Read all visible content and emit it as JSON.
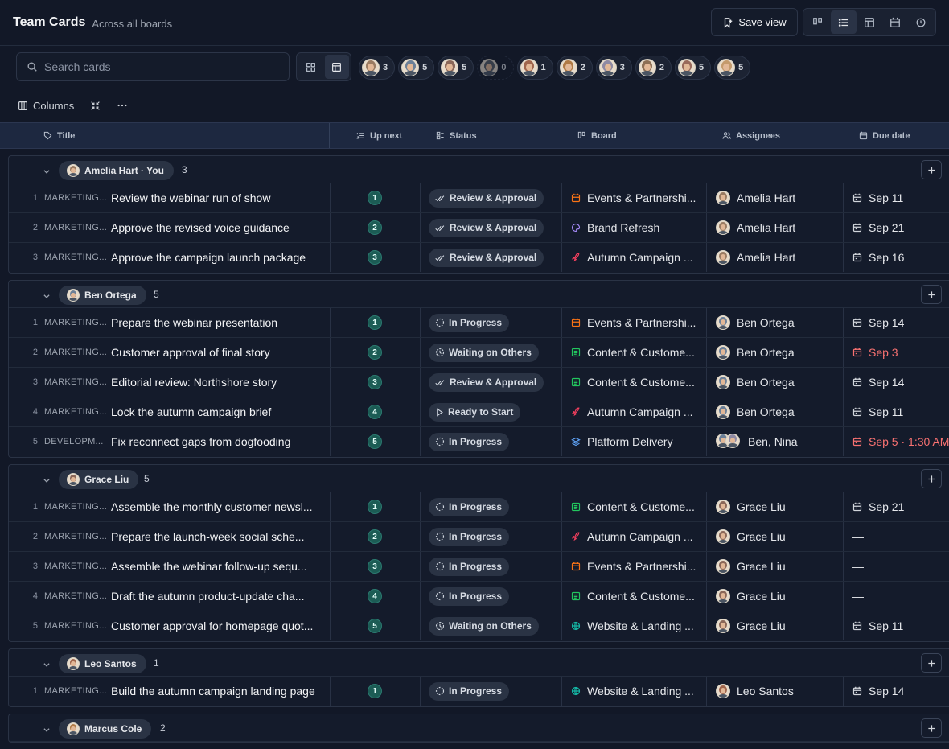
{
  "header": {
    "title": "Team Cards",
    "subtitle": "Across all boards",
    "save_view_label": "Save view"
  },
  "search": {
    "placeholder": "Search cards",
    "value": ""
  },
  "assignee_chips": [
    {
      "count": "3",
      "tone": "#9a7b62"
    },
    {
      "count": "5",
      "tone": "#6b7f97"
    },
    {
      "count": "5",
      "tone": "#8a6758"
    },
    {
      "count": "0",
      "tone": "#555c66"
    },
    {
      "count": "1",
      "tone": "#a0664d"
    },
    {
      "count": "2",
      "tone": "#b07a45"
    },
    {
      "count": "3",
      "tone": "#8f8aa3"
    },
    {
      "count": "2",
      "tone": "#8d6f55"
    },
    {
      "count": "5",
      "tone": "#9a6a5b"
    },
    {
      "count": "5",
      "tone": "#c49a6c"
    }
  ],
  "toolbar": {
    "columns_label": "Columns"
  },
  "columns": {
    "title": "Title",
    "up_next": "Up next",
    "status": "Status",
    "board": "Board",
    "assignees": "Assignees",
    "due_date": "Due date"
  },
  "colors": {
    "accent_teal": "#1c5c55",
    "overdue": "#f87171",
    "events": "#f97316",
    "brand": "#a78bfa",
    "content": "#22c55e",
    "autumn": "#f43f5e",
    "platform": "#60a5fa",
    "website": "#14b8a6"
  },
  "groups": [
    {
      "name": "Amelia Hart · You",
      "count": "3",
      "tone": "#9a7b62",
      "rows": [
        {
          "idx": "1",
          "prefix": "MARKETING...",
          "title": "Review the webinar run of show",
          "up": "1",
          "status": "Review & Approval",
          "status_icon": "review",
          "board": "Events & Partnershi...",
          "board_icon": "calendar",
          "board_color": "#f97316",
          "assignee": "Amelia Hart",
          "av": [
            "#9a7b62"
          ],
          "due": "Sep 11",
          "overdue": false
        },
        {
          "idx": "2",
          "prefix": "MARKETING...",
          "title": "Approve the revised voice guidance",
          "up": "2",
          "status": "Review & Approval",
          "status_icon": "review",
          "board": "Brand Refresh",
          "board_icon": "palette",
          "board_color": "#a78bfa",
          "assignee": "Amelia Hart",
          "av": [
            "#9a7b62"
          ],
          "due": "Sep 21",
          "overdue": false
        },
        {
          "idx": "3",
          "prefix": "MARKETING...",
          "title": "Approve the campaign launch package",
          "up": "3",
          "status": "Review & Approval",
          "status_icon": "review",
          "board": "Autumn Campaign ...",
          "board_icon": "rocket",
          "board_color": "#f43f5e",
          "assignee": "Amelia Hart",
          "av": [
            "#9a7b62"
          ],
          "due": "Sep 16",
          "overdue": false
        }
      ]
    },
    {
      "name": "Ben Ortega",
      "count": "5",
      "tone": "#6b7f97",
      "rows": [
        {
          "idx": "1",
          "prefix": "MARKETING...",
          "title": "Prepare the webinar presentation",
          "up": "1",
          "status": "In Progress",
          "status_icon": "progress",
          "board": "Events & Partnershi...",
          "board_icon": "calendar",
          "board_color": "#f97316",
          "assignee": "Ben Ortega",
          "av": [
            "#6b7f97"
          ],
          "due": "Sep 14",
          "overdue": false
        },
        {
          "idx": "2",
          "prefix": "MARKETING...",
          "title": "Customer approval of final story",
          "up": "2",
          "status": "Waiting on Others",
          "status_icon": "waiting",
          "board": "Content & Custome...",
          "board_icon": "list",
          "board_color": "#22c55e",
          "assignee": "Ben Ortega",
          "av": [
            "#6b7f97"
          ],
          "due": "Sep 3",
          "overdue": true
        },
        {
          "idx": "3",
          "prefix": "MARKETING...",
          "title": "Editorial review: Northshore story",
          "up": "3",
          "status": "Review & Approval",
          "status_icon": "review",
          "board": "Content & Custome...",
          "board_icon": "list",
          "board_color": "#22c55e",
          "assignee": "Ben Ortega",
          "av": [
            "#6b7f97"
          ],
          "due": "Sep 14",
          "overdue": false
        },
        {
          "idx": "4",
          "prefix": "MARKETING...",
          "title": "Lock the autumn campaign brief",
          "up": "4",
          "status": "Ready to Start",
          "status_icon": "ready",
          "board": "Autumn Campaign ...",
          "board_icon": "rocket",
          "board_color": "#f43f5e",
          "assignee": "Ben Ortega",
          "av": [
            "#6b7f97"
          ],
          "due": "Sep 11",
          "overdue": false
        },
        {
          "idx": "5",
          "prefix": "DEVELOPM...",
          "title": "Fix reconnect gaps from dogfooding",
          "up": "5",
          "status": "In Progress",
          "status_icon": "progress",
          "board": "Platform Delivery",
          "board_icon": "layers",
          "board_color": "#60a5fa",
          "assignee": "Ben, Nina",
          "av": [
            "#6b7f97",
            "#8f8aa3"
          ],
          "due": "Sep 5 · 1:30 AM",
          "overdue": true
        }
      ]
    },
    {
      "name": "Grace Liu",
      "count": "5",
      "tone": "#8a6758",
      "rows": [
        {
          "idx": "1",
          "prefix": "MARKETING...",
          "title": "Assemble the monthly customer newsl...",
          "up": "1",
          "status": "In Progress",
          "status_icon": "progress",
          "board": "Content & Custome...",
          "board_icon": "list",
          "board_color": "#22c55e",
          "assignee": "Grace Liu",
          "av": [
            "#8a6758"
          ],
          "due": "Sep 21",
          "overdue": false
        },
        {
          "idx": "2",
          "prefix": "MARKETING...",
          "title": "Prepare the launch-week social sche...",
          "up": "2",
          "status": "In Progress",
          "status_icon": "progress",
          "board": "Autumn Campaign ...",
          "board_icon": "rocket",
          "board_color": "#f43f5e",
          "assignee": "Grace Liu",
          "av": [
            "#8a6758"
          ],
          "due": "—",
          "overdue": false
        },
        {
          "idx": "3",
          "prefix": "MARKETING...",
          "title": "Assemble the webinar follow-up sequ...",
          "up": "3",
          "status": "In Progress",
          "status_icon": "progress",
          "board": "Events & Partnershi...",
          "board_icon": "calendar",
          "board_color": "#f97316",
          "assignee": "Grace Liu",
          "av": [
            "#8a6758"
          ],
          "due": "—",
          "overdue": false
        },
        {
          "idx": "4",
          "prefix": "MARKETING...",
          "title": "Draft the autumn product-update cha...",
          "up": "4",
          "status": "In Progress",
          "status_icon": "progress",
          "board": "Content & Custome...",
          "board_icon": "list",
          "board_color": "#22c55e",
          "assignee": "Grace Liu",
          "av": [
            "#8a6758"
          ],
          "due": "—",
          "overdue": false
        },
        {
          "idx": "5",
          "prefix": "MARKETING...",
          "title": "Customer approval for homepage quot...",
          "up": "5",
          "status": "Waiting on Others",
          "status_icon": "waiting",
          "board": "Website & Landing ...",
          "board_icon": "globe",
          "board_color": "#14b8a6",
          "assignee": "Grace Liu",
          "av": [
            "#8a6758"
          ],
          "due": "Sep 11",
          "overdue": false
        }
      ]
    },
    {
      "name": "Leo Santos",
      "count": "1",
      "tone": "#a0664d",
      "rows": [
        {
          "idx": "1",
          "prefix": "MARKETING...",
          "title": "Build the autumn campaign landing page",
          "up": "1",
          "status": "In Progress",
          "status_icon": "progress",
          "board": "Website & Landing ...",
          "board_icon": "globe",
          "board_color": "#14b8a6",
          "assignee": "Leo Santos",
          "av": [
            "#a0664d"
          ],
          "due": "Sep 14",
          "overdue": false
        }
      ]
    },
    {
      "name": "Marcus Cole",
      "count": "2",
      "tone": "#b07a45",
      "rows": []
    }
  ]
}
